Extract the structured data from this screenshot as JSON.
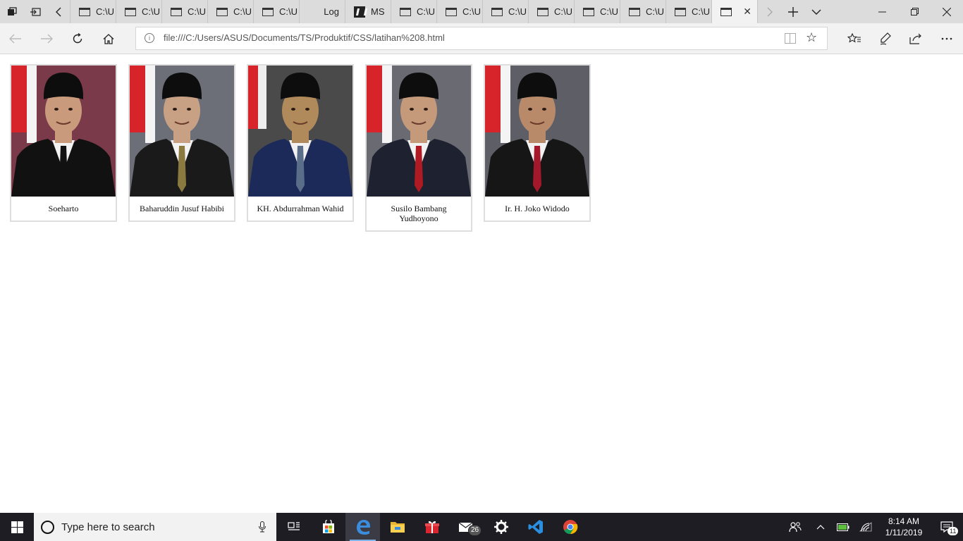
{
  "browser": {
    "tabs": [
      {
        "label": "C:\\U",
        "kind": "page"
      },
      {
        "label": "C:\\U",
        "kind": "page"
      },
      {
        "label": "C:\\U",
        "kind": "page"
      },
      {
        "label": "C:\\U",
        "kind": "page"
      },
      {
        "label": "C:\\U",
        "kind": "page"
      },
      {
        "label": "Log",
        "kind": "log"
      },
      {
        "label": "MSN",
        "kind": "msn"
      },
      {
        "label": "C:\\U",
        "kind": "page"
      },
      {
        "label": "C:\\U",
        "kind": "page"
      },
      {
        "label": "C:\\U",
        "kind": "page"
      },
      {
        "label": "C:\\U",
        "kind": "page"
      },
      {
        "label": "C:\\U",
        "kind": "page"
      },
      {
        "label": "C:\\U",
        "kind": "page"
      },
      {
        "label": "C:\\U",
        "kind": "page"
      }
    ],
    "url": "file:///C:/Users/ASUS/Documents/TS/Produktif/CSS/latihan%208.html"
  },
  "presidents": [
    {
      "name": "Soeharto",
      "bg": "#7a3a4a",
      "suit": "#111111",
      "tie": "#111111",
      "skin": "#c99a7c"
    },
    {
      "name": "Baharuddin Jusuf Habibi",
      "bg": "#6c6e78",
      "suit": "#1a1a1a",
      "tie": "#8a7a40",
      "skin": "#c8a084"
    },
    {
      "name": "KH. Abdurrahman Wahid",
      "bg": "#4a4a4a",
      "suit": "#1c2a5a",
      "tie": "#5a6e8a",
      "skin": "#b08a5a"
    },
    {
      "name": "Susilo Bambang Yudhoyono",
      "bg": "#6a6a72",
      "suit": "#1e2230",
      "tie": "#b01a22",
      "skin": "#c49a7a"
    },
    {
      "name": "Ir. H. Joko Widodo",
      "bg": "#5e5e66",
      "suit": "#161616",
      "tie": "#a3182a",
      "skin": "#b88a6a"
    }
  ],
  "taskbar": {
    "search_placeholder": "Type here to search",
    "mail_badge": "26",
    "time": "8:14 AM",
    "date": "1/11/2019",
    "notification_count": "11"
  }
}
